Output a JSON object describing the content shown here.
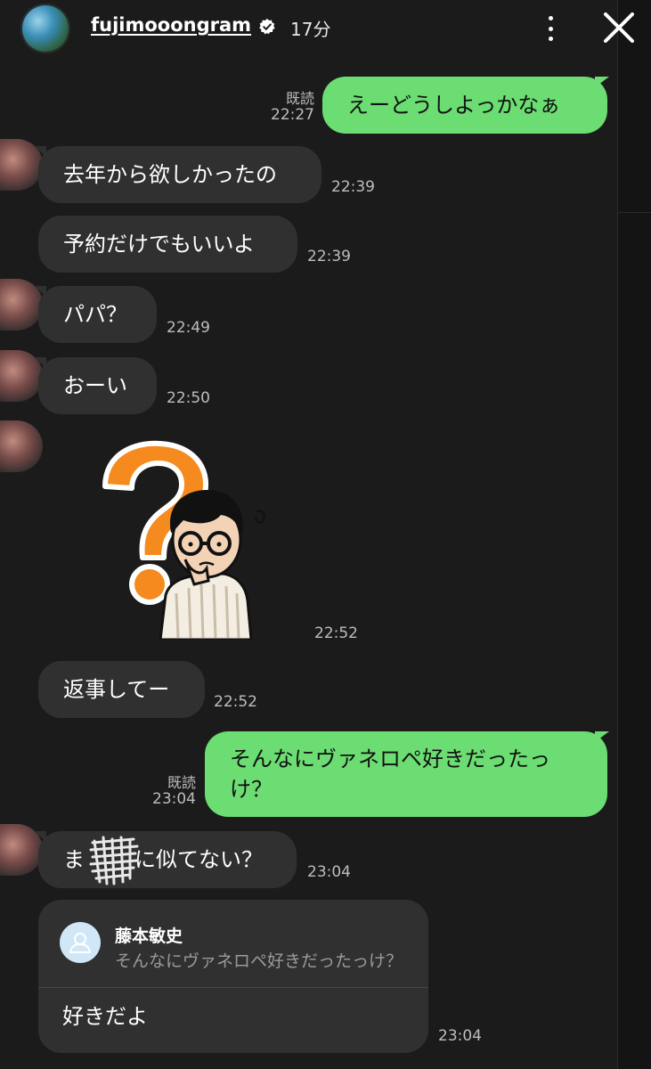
{
  "header": {
    "username": "fujimooongram",
    "time_ago": "17分"
  },
  "messages": [
    {
      "side": "out",
      "text": "えーどうしよっかなぁ",
      "read": "既読",
      "time": "22:27"
    },
    {
      "side": "in",
      "text": "去年から欲しかったの",
      "time": "22:39"
    },
    {
      "side": "in",
      "text": "予約だけでもいいよ",
      "time": "22:39"
    },
    {
      "side": "in",
      "text": "パパ？",
      "time": "22:49"
    },
    {
      "side": "in",
      "text": "おーい",
      "time": "22:50"
    },
    {
      "side": "in",
      "type": "sticker",
      "time": "22:52"
    },
    {
      "side": "in",
      "text": "返事してー",
      "time": "22:52"
    },
    {
      "side": "out",
      "line1": "そんなにヴァネロペ好きだったっ",
      "line2": "け？",
      "read": "既読",
      "time": "23:04"
    },
    {
      "side": "in",
      "text_start": "ま",
      "text_end": "に似てない？",
      "time": "23:04"
    },
    {
      "side": "in",
      "type": "reply",
      "quoted_name": "藤本敏史",
      "quoted_text": "そんなにヴァネロペ好きだったっけ？",
      "text": "好きだよ",
      "time": "23:04"
    }
  ],
  "colors": {
    "background": "#1b1b1b",
    "incoming_bubble": "#303030",
    "outgoing_bubble": "#6bdd72",
    "sticker_question": "#f58a1f"
  }
}
